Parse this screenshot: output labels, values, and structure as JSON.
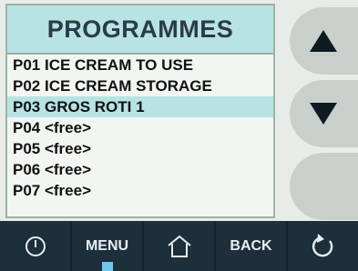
{
  "screen": {
    "title": "PROGRAMMES",
    "programmes": [
      {
        "label": "P01 ICE CREAM TO USE",
        "selected": false
      },
      {
        "label": "P02 ICE CREAM STORAGE",
        "selected": false
      },
      {
        "label": "P03 GROS ROTI 1",
        "selected": true
      },
      {
        "label": "P04 <free>",
        "selected": false
      },
      {
        "label": "P05 <free>",
        "selected": false
      },
      {
        "label": "P06 <free>",
        "selected": false
      },
      {
        "label": "P07 <free>",
        "selected": false
      }
    ]
  },
  "side_buttons": {
    "up_icon": "triangle-up-icon",
    "down_icon": "triangle-down-icon",
    "blank": "blank"
  },
  "toolbar": {
    "power_icon": "power-icon",
    "menu_label": "MENU",
    "home_icon": "home-icon",
    "back_label": "BACK",
    "refresh_icon": "refresh-icon"
  },
  "colors": {
    "highlight": "#b7e3e3",
    "toolbar": "#1c2f3a",
    "menu_indicator": "#6ec8ee"
  }
}
